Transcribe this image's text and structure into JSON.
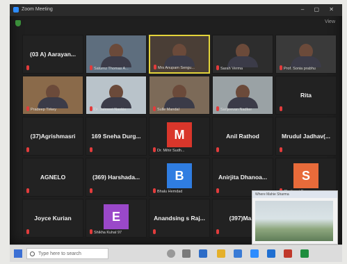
{
  "window": {
    "title": "Zoom Meeting"
  },
  "topbar": {
    "meeting_label": "",
    "view_label": "View"
  },
  "tiles": [
    {
      "type": "name",
      "name": "(03 A) Aarayan...",
      "caption": ""
    },
    {
      "type": "video",
      "name": "",
      "caption": "Saturnz Thomas A...",
      "bg": "#5e6e7e"
    },
    {
      "type": "video",
      "name": "",
      "caption": "Mrs Anupam Sengu...",
      "bg": "#4a3e36",
      "highlight": true
    },
    {
      "type": "video",
      "name": "",
      "caption": "Sarah Verma",
      "bg": "#2d2d2d"
    },
    {
      "type": "video",
      "name": "",
      "caption": "Prof. Sonia prabhu",
      "bg": "#3a3a3a"
    },
    {
      "type": "video",
      "name": "",
      "caption": "Pradeep Tirkey",
      "bg": "#8a6a4a"
    },
    {
      "type": "video",
      "name": "",
      "caption": "Dr. Jaimeet Nankin",
      "bg": "#b9c3ca"
    },
    {
      "type": "video",
      "name": "",
      "caption": "Sulle Mandal",
      "bg": "#7c6a58"
    },
    {
      "type": "video",
      "name": "",
      "caption": "Sanjeevan Nadker",
      "bg": "#9aa2a5"
    },
    {
      "type": "name",
      "name": "Rita",
      "caption": ""
    },
    {
      "type": "name",
      "name": "(37)Agrishmasri",
      "caption": ""
    },
    {
      "type": "name",
      "name": "169 Sneha Durg...",
      "caption": ""
    },
    {
      "type": "avatar",
      "letter": "M",
      "avatar_color": "#d9362b",
      "caption": "Dr. Mihir Sudh..."
    },
    {
      "type": "name",
      "name": "Anil Rathod",
      "caption": ""
    },
    {
      "type": "name",
      "name": "Mrudul Jadhav(...",
      "caption": ""
    },
    {
      "type": "name",
      "name": "AGNELO",
      "caption": ""
    },
    {
      "type": "name",
      "name": "(369) Harshada...",
      "caption": ""
    },
    {
      "type": "avatar",
      "letter": "B",
      "avatar_color": "#2f7de1",
      "caption": "Bhalu Hemdad"
    },
    {
      "type": "name",
      "name": "Anirjita Dhanoa...",
      "caption": ""
    },
    {
      "type": "avatar",
      "letter": "S",
      "avatar_color": "#e86b3a",
      "caption": "Chaitanyi Sur..."
    },
    {
      "type": "name",
      "name": "Joyce Kurian",
      "caption": ""
    },
    {
      "type": "avatar",
      "letter": "E",
      "avatar_color": "#9a48c9",
      "caption": "Shikha Kuhal 97"
    },
    {
      "type": "name",
      "name": "Anandsing s Raj...",
      "caption": ""
    },
    {
      "type": "name",
      "name": "(397)Ma...",
      "caption": ""
    },
    {
      "type": "name",
      "name": "",
      "caption": ""
    }
  ],
  "popup": {
    "title": "Where Mahie Sharma"
  },
  "taskbar": {
    "search_placeholder": "Type here to search"
  }
}
